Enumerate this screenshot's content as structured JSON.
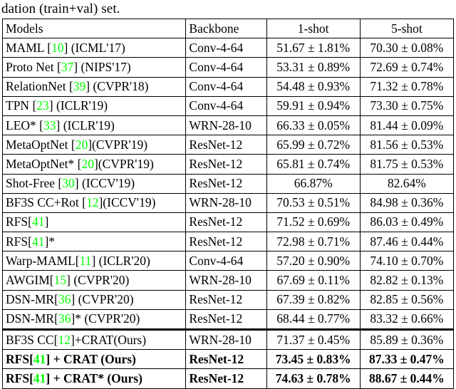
{
  "caption": {
    "text": "dation (train+val) set."
  },
  "colors": {
    "citation_green": "#00ff00",
    "text": "#000000",
    "rule": "#000000"
  },
  "table": {
    "columns": [
      "Models",
      "Backbone",
      "1-shot",
      "5-shot"
    ],
    "rows": [
      {
        "model_name": "MAML",
        "citation": "10",
        "venue": "(ICML'17)",
        "star": false,
        "model_display": "MAML [10] (ICML'17)",
        "backbone": "Conv-4-64",
        "one_shot": "51.67 ± 1.81%",
        "five_shot": "70.30 ± 0.08%",
        "bold": false
      },
      {
        "model_name": "Proto Net",
        "citation": "37",
        "venue": "(NIPS'17)",
        "star": false,
        "model_display": "Proto Net [37] (NIPS'17)",
        "backbone": "Conv-4-64",
        "one_shot": "53.31 ± 0.89%",
        "five_shot": "72.69 ± 0.74%",
        "bold": false
      },
      {
        "model_name": "RelationNet",
        "citation": "39",
        "venue": "(CVPR'18)",
        "star": false,
        "model_display": "RelationNet [39] (CVPR'18)",
        "backbone": "Conv-4-64",
        "one_shot": "54.48 ± 0.93%",
        "five_shot": "71.32 ± 0.78%",
        "bold": false
      },
      {
        "model_name": "TPN",
        "citation": "23",
        "venue": "(ICLR'19)",
        "star": false,
        "model_display": "TPN [23] (ICLR'19)",
        "backbone": "Conv-4-64",
        "one_shot": "59.91 ± 0.94%",
        "five_shot": "73.30 ± 0.75%",
        "bold": false
      },
      {
        "model_name": "LEO",
        "citation": "33",
        "venue": "(ICLR'19)",
        "star": true,
        "model_display": "LEO* [33] (ICLR'19)",
        "backbone": "WRN-28-10",
        "one_shot": "66.33 ± 0.05%",
        "five_shot": "81.44 ± 0.09%",
        "bold": false
      },
      {
        "model_name": "MetaOptNet",
        "citation": "20",
        "venue": "(CVPR'19)",
        "star": false,
        "model_display": "MetaOptNet [20](CVPR'19)",
        "backbone": "ResNet-12",
        "one_shot": "65.99 ± 0.72%",
        "five_shot": "81.56 ± 0.53%",
        "bold": false
      },
      {
        "model_name": "MetaOptNet",
        "citation": "20",
        "venue": "(CVPR'19)",
        "star": true,
        "model_display": "MetaOptNet* [20](CVPR'19)",
        "backbone": "ResNet-12",
        "one_shot": "65.81 ± 0.74%",
        "five_shot": "81.75 ± 0.53%",
        "bold": false
      },
      {
        "model_name": "Shot-Free",
        "citation": "30",
        "venue": "(ICCV'19)",
        "star": false,
        "model_display": "Shot-Free [30] (ICCV'19)",
        "backbone": "ResNet-12",
        "one_shot": "66.87%",
        "five_shot": "82.64%",
        "bold": false
      },
      {
        "model_name": "BF3S CC+Rot",
        "citation": "12",
        "venue": "(ICCV'19)",
        "star": false,
        "model_display": "BF3S CC+Rot [12](ICCV'19)",
        "backbone": "WRN-28-10",
        "one_shot": "70.53 ± 0.51%",
        "five_shot": "84.98 ± 0.36%",
        "bold": false
      },
      {
        "model_name": "RFS",
        "citation": "41",
        "venue": "",
        "star": false,
        "model_display": "RFS[41]",
        "backbone": "ResNet-12",
        "one_shot": "71.52 ± 0.69%",
        "five_shot": "86.03 ± 0.49%",
        "bold": false
      },
      {
        "model_name": "RFS",
        "citation": "41",
        "venue": "",
        "star": true,
        "model_display": "RFS[41]*",
        "backbone": "ResNet-12",
        "one_shot": "72.98 ± 0.71%",
        "five_shot": "87.46 ± 0.44%",
        "bold": false
      },
      {
        "model_name": "Warp-MAML",
        "citation": "11",
        "venue": "(ICLR'20)",
        "star": false,
        "model_display": "Warp-MAML[11] (ICLR'20)",
        "backbone": "Conv-4-64",
        "one_shot": "57.20 ± 0.90%",
        "five_shot": "74.10 ± 0.70%",
        "bold": false
      },
      {
        "model_name": "AWGIM",
        "citation": "15",
        "venue": "(CVPR'20)",
        "star": false,
        "model_display": "AWGIM[15] (CVPR'20)",
        "backbone": "WRN-28-10",
        "one_shot": "67.69 ± 0.11%",
        "five_shot": "82.82 ± 0.13%",
        "bold": false
      },
      {
        "model_name": "DSN-MR",
        "citation": "36",
        "venue": "(CVPR'20)",
        "star": false,
        "model_display": "DSN-MR[36] (CVPR'20)",
        "backbone": "ResNet-12",
        "one_shot": "67.39 ± 0.82%",
        "five_shot": "82.85 ± 0.56%",
        "bold": false
      },
      {
        "model_name": "DSN-MR",
        "citation": "36",
        "venue": "(CVPR'20)",
        "star": true,
        "model_display": "DSN-MR[36]* (CVPR'20)",
        "backbone": "ResNet-12",
        "one_shot": "68.44 ± 0.77%",
        "five_shot": "83.32 ± 0.66%",
        "bold": false
      }
    ],
    "ours_rows": [
      {
        "model_name": "BF3S CC",
        "citation": "12",
        "venue": "+CRAT(Ours)",
        "star": false,
        "model_display": "BF3S CC[12]+CRAT(Ours)",
        "backbone": "WRN-28-10",
        "one_shot": "71.37 ± 0.45%",
        "five_shot": "85.89 ± 0.36%",
        "bold": false
      },
      {
        "model_name": "RFS",
        "citation": "41",
        "venue": " + CRAT (Ours)",
        "star": false,
        "model_display": "RFS[41] + CRAT (Ours)",
        "backbone": "ResNet-12",
        "one_shot": "73.45 ± 0.83%",
        "five_shot": "87.33 ± 0.47%",
        "bold": true
      },
      {
        "model_name": "RFS",
        "citation": "41",
        "venue": " + CRAT* (Ours)",
        "star": true,
        "model_display": "RFS[41] + CRAT* (Ours)",
        "backbone": "ResNet-12",
        "one_shot": "74.63 ± 0.78%",
        "five_shot": "88.67 ± 0.44%",
        "bold": true
      }
    ]
  }
}
